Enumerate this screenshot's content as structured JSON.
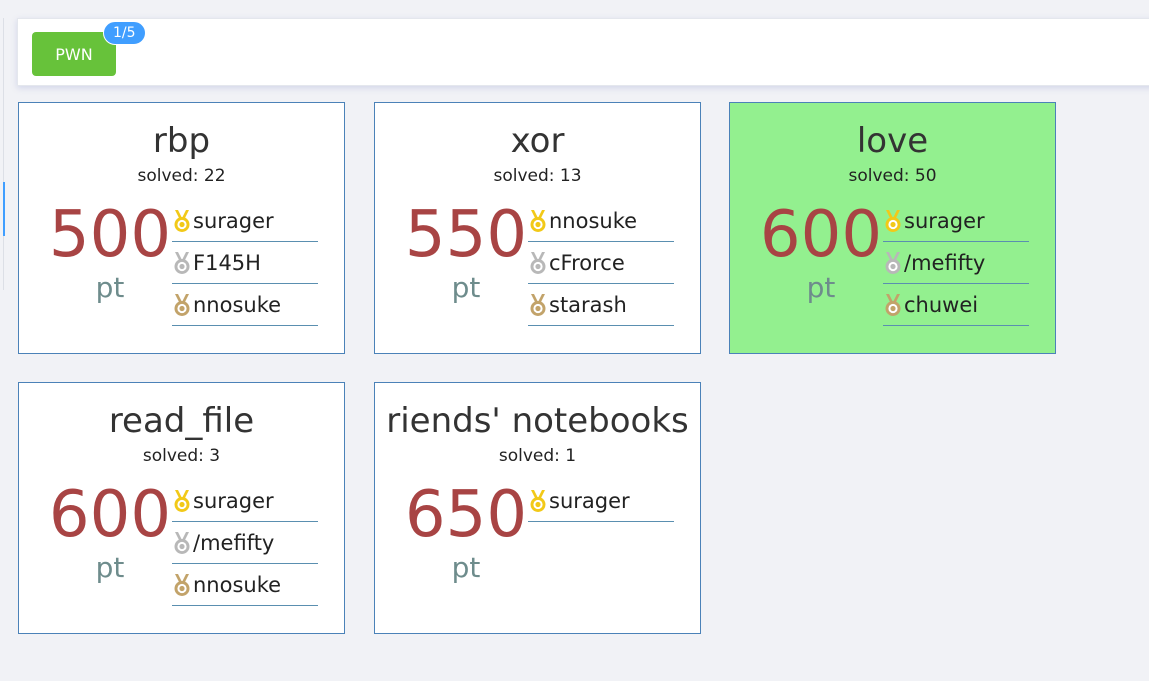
{
  "category": {
    "label": "PWN",
    "progress": "1/5"
  },
  "colors": {
    "gold": "#f2c918",
    "silver": "#b8b8b8",
    "bronze": "#c2a36a",
    "solved_card": "#93f08f",
    "score": "#a84444"
  },
  "challenges": [
    {
      "name": "rbp",
      "solved_label": "solved: 22",
      "score": "500",
      "unit": "pt",
      "is_solved": false,
      "solvers": [
        {
          "rank": "gold",
          "name": "surager"
        },
        {
          "rank": "silver",
          "name": " F145H"
        },
        {
          "rank": "bronze",
          "name": "nnosuke"
        }
      ]
    },
    {
      "name": "xor",
      "solved_label": "solved: 13",
      "score": "550",
      "unit": "pt",
      "is_solved": false,
      "solvers": [
        {
          "rank": "gold",
          "name": "nnosuke"
        },
        {
          "rank": "silver",
          "name": "cFrorce"
        },
        {
          "rank": "bronze",
          "name": "starash"
        }
      ]
    },
    {
      "name": "love",
      "solved_label": "solved: 50",
      "score": "600",
      "unit": "pt",
      "is_solved": true,
      "solvers": [
        {
          "rank": "gold",
          "name": "surager"
        },
        {
          "rank": "silver",
          "name": "/mefifty"
        },
        {
          "rank": "bronze",
          "name": " chuwei"
        }
      ]
    },
    {
      "name": "read_file",
      "solved_label": "solved: 3",
      "score": "600",
      "unit": "pt",
      "is_solved": false,
      "solvers": [
        {
          "rank": "gold",
          "name": "surager"
        },
        {
          "rank": "silver",
          "name": "/mefifty"
        },
        {
          "rank": "bronze",
          "name": "nnosuke"
        }
      ]
    },
    {
      "name": "riends' notebooks",
      "solved_label": "solved: 1",
      "score": "650",
      "unit": "pt",
      "is_solved": false,
      "solvers": [
        {
          "rank": "gold",
          "name": "surager"
        }
      ]
    }
  ]
}
